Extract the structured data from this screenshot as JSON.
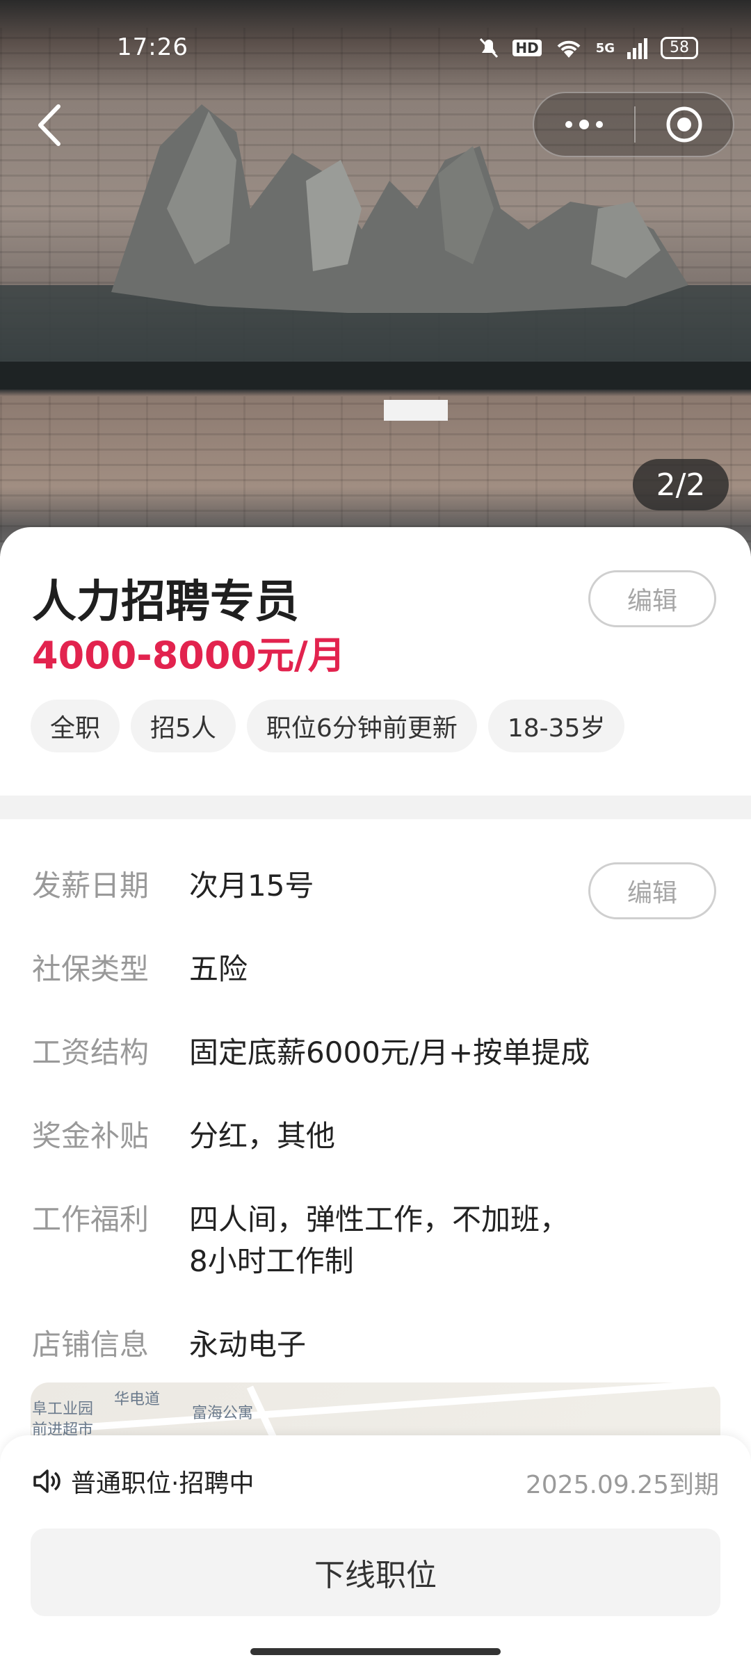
{
  "status_bar": {
    "time": "17:26",
    "network_hd": "HD",
    "network_5g": "5G",
    "battery": "58"
  },
  "gallery": {
    "counter": "2/2"
  },
  "job": {
    "title": "人力招聘专员",
    "salary": "4000-8000元/月",
    "edit_label": "编辑",
    "tags": [
      "全职",
      "招5人",
      "职位6分钟前更新",
      "18-35岁"
    ]
  },
  "details": {
    "edit_label": "编辑",
    "rows": [
      {
        "key": "发薪日期",
        "value": "次月15号"
      },
      {
        "key": "社保类型",
        "value": "五险"
      },
      {
        "key": "工资结构",
        "value": "固定底薪6000元/月+按单提成"
      },
      {
        "key": "奖金补贴",
        "value": "分红，其他"
      },
      {
        "key": "工作福利",
        "value": "四人间，弹性工作，不加班，",
        "value2": "8小时工作制"
      },
      {
        "key": "店铺信息",
        "value": "永动电子"
      }
    ]
  },
  "map": {
    "labels": [
      "华电道",
      "富海公寓",
      "前进超市",
      "阜工业园"
    ]
  },
  "footer": {
    "status_text": "普通职位·招聘中",
    "expire_text": "2025.09.25到期",
    "offline_label": "下线职位"
  },
  "colors": {
    "salary": "#e2234e",
    "muted": "#999999"
  }
}
